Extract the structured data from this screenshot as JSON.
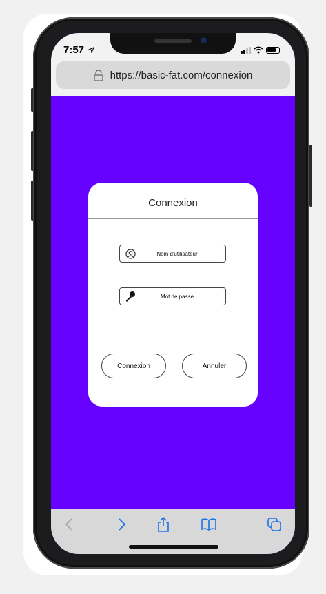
{
  "status_bar": {
    "time": "7:57",
    "location_arrow_icon": "location-arrow-icon",
    "signal_icon": "signal-icon",
    "wifi_icon": "wifi-icon",
    "battery_icon": "battery-icon"
  },
  "browser": {
    "url": "https://basic-fat.com/connexion",
    "lock_icon": "lock-icon"
  },
  "dialog": {
    "title": "Connexion",
    "username_placeholder": "Nom d'utilisateur",
    "password_placeholder": "Mot de passe",
    "login_button": "Connexion",
    "cancel_button": "Annuler"
  },
  "toolbar": {
    "icons": [
      "back-icon",
      "forward-icon",
      "share-icon",
      "bookmarks-icon",
      "tabs-icon"
    ]
  },
  "colors": {
    "page_background": "#6600ff",
    "toolbar_accent": "#1a73e8",
    "disabled_icon": "#a8a8a8"
  }
}
